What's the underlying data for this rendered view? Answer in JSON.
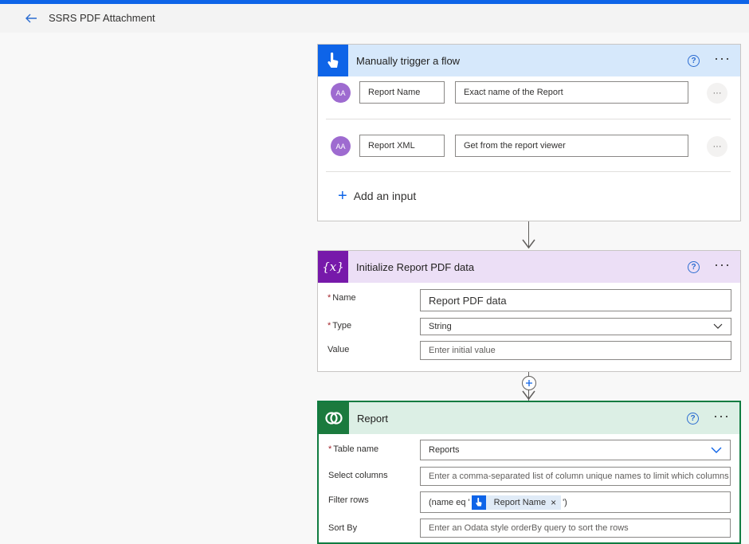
{
  "header": {
    "title": "SSRS PDF Attachment"
  },
  "trigger": {
    "title": "Manually trigger a flow",
    "help": "?",
    "more": "···",
    "inputs": [
      {
        "avatar": "AA",
        "name": "Report Name",
        "placeholder": "Exact name of the Report",
        "more": "···"
      },
      {
        "avatar": "AA",
        "name": "Report XML",
        "placeholder": "Get from the report viewer",
        "more": "···"
      }
    ],
    "add_input": "Add an input"
  },
  "init": {
    "title": "Initialize Report PDF data",
    "help": "?",
    "more": "···",
    "fields": {
      "name_label": "Name",
      "name_value": "Report PDF data",
      "type_label": "Type",
      "type_value": "String",
      "value_label": "Value",
      "value_placeholder": "Enter initial value"
    }
  },
  "report": {
    "title": "Report",
    "help": "?",
    "more": "···",
    "fields": {
      "table_label": "Table name",
      "table_value": "Reports",
      "select_label": "Select columns",
      "select_placeholder": "Enter a comma-separated list of column unique names to limit which columns",
      "filter_label": "Filter rows",
      "filter_prefix": "(name eq '",
      "filter_chip": "Report Name",
      "filter_suffix": "')",
      "sort_label": "Sort By",
      "sort_placeholder": "Enter an Odata style orderBy query to sort the rows"
    }
  },
  "colors": {
    "accent": "#0e64e8",
    "trigger_header": "#d6e8fb",
    "init_header": "#ecdff6",
    "init_icon": "#7719aa",
    "report_header": "#dcefe5",
    "report_icon": "#1b7a3e",
    "report_border": "#107c41"
  }
}
